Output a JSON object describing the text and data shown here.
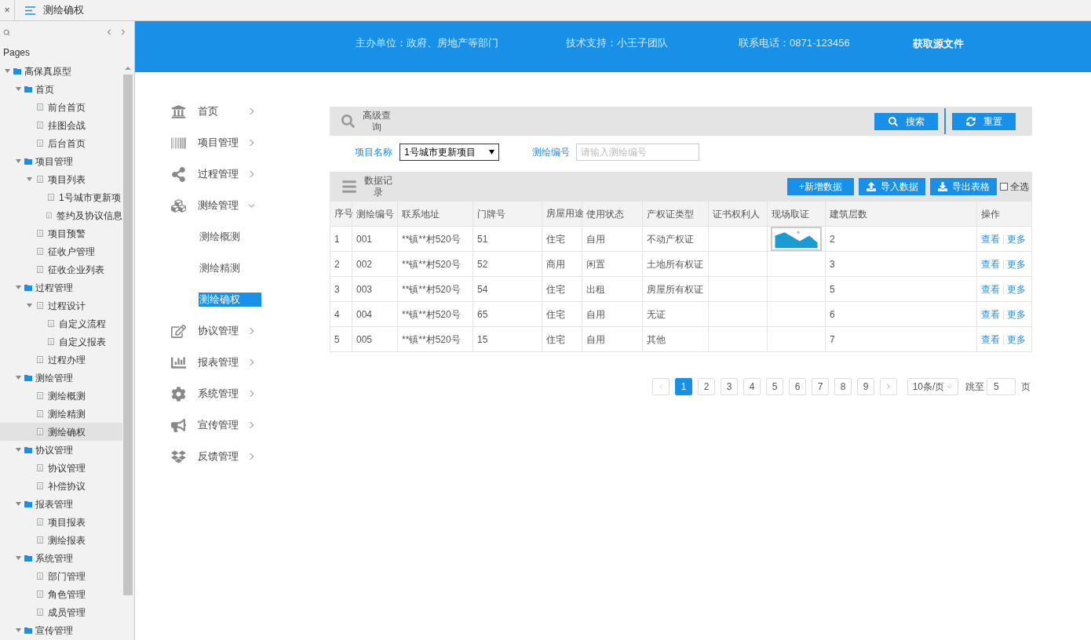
{
  "tab": {
    "close": "×",
    "title": "测绘确权"
  },
  "sidebar": {
    "heading": "Pages",
    "tree": [
      {
        "label": "高保真原型",
        "kind": "folder",
        "expanded": true,
        "selected": false,
        "children": [
          {
            "label": "首页",
            "kind": "folder",
            "expanded": true,
            "selected": false,
            "children": [
              {
                "label": "前台首页",
                "kind": "page",
                "selected": false
              },
              {
                "label": "挂图会战",
                "kind": "page",
                "selected": false
              },
              {
                "label": "后台首页",
                "kind": "page",
                "selected": false
              }
            ]
          },
          {
            "label": "项目管理",
            "kind": "folder",
            "expanded": true,
            "selected": false,
            "children": [
              {
                "label": "项目列表",
                "kind": "page",
                "expanded": true,
                "selected": false,
                "children": [
                  {
                    "label": "1号城市更新项",
                    "kind": "page",
                    "selected": false
                  },
                  {
                    "label": "签约及协议信息",
                    "kind": "page",
                    "selected": false
                  }
                ]
              },
              {
                "label": "项目预警",
                "kind": "page",
                "selected": false
              },
              {
                "label": "征收户管理",
                "kind": "page",
                "selected": false
              },
              {
                "label": "征收企业列表",
                "kind": "page",
                "selected": false
              }
            ]
          },
          {
            "label": "过程管理",
            "kind": "folder",
            "expanded": true,
            "selected": false,
            "children": [
              {
                "label": "过程设计",
                "kind": "page",
                "expanded": true,
                "selected": false,
                "children": [
                  {
                    "label": "自定义流程",
                    "kind": "page",
                    "selected": false
                  },
                  {
                    "label": "自定义报表",
                    "kind": "page",
                    "selected": false
                  }
                ]
              },
              {
                "label": "过程办理",
                "kind": "page",
                "selected": false
              }
            ]
          },
          {
            "label": "测绘管理",
            "kind": "folder",
            "expanded": true,
            "selected": false,
            "children": [
              {
                "label": "测绘概测",
                "kind": "page",
                "selected": false
              },
              {
                "label": "测绘精测",
                "kind": "page",
                "selected": false
              },
              {
                "label": "测绘确权",
                "kind": "page",
                "selected": true
              }
            ]
          },
          {
            "label": "协议管理",
            "kind": "folder",
            "expanded": true,
            "selected": false,
            "children": [
              {
                "label": "协议管理",
                "kind": "page",
                "selected": false
              },
              {
                "label": "补偿协议",
                "kind": "page",
                "selected": false
              }
            ]
          },
          {
            "label": "报表管理",
            "kind": "folder",
            "expanded": true,
            "selected": false,
            "children": [
              {
                "label": "项目报表",
                "kind": "page",
                "selected": false
              },
              {
                "label": "测绘报表",
                "kind": "page",
                "selected": false
              }
            ]
          },
          {
            "label": "系统管理",
            "kind": "folder",
            "expanded": true,
            "selected": false,
            "children": [
              {
                "label": "部门管理",
                "kind": "page",
                "selected": false
              },
              {
                "label": "角色管理",
                "kind": "page",
                "selected": false
              },
              {
                "label": "成员管理",
                "kind": "page",
                "selected": false
              }
            ]
          },
          {
            "label": "宣传管理",
            "kind": "folder",
            "expanded": true,
            "selected": false
          }
        ]
      }
    ]
  },
  "header": {
    "sponsor": "主办单位：政府、房地产等部门",
    "support": "技术支持：小王子团队",
    "phone": "联系电话：0871-123456",
    "link": "获取源文件"
  },
  "nav": [
    {
      "label": "首页",
      "expanded": false
    },
    {
      "label": "项目管理",
      "expanded": false
    },
    {
      "label": "过程管理",
      "expanded": false
    },
    {
      "label": "测绘管理",
      "expanded": true,
      "children": [
        {
          "label": "测绘概测",
          "selected": false
        },
        {
          "label": "测绘精测",
          "selected": false
        },
        {
          "label": "测绘确权",
          "selected": true
        }
      ]
    },
    {
      "label": "协议管理",
      "expanded": false
    },
    {
      "label": "报表管理",
      "expanded": false
    },
    {
      "label": "系统管理",
      "expanded": false
    },
    {
      "label": "宣传管理",
      "expanded": false
    },
    {
      "label": "反馈管理",
      "expanded": false
    }
  ],
  "search_panel": {
    "title": "高级查询",
    "search_button": "搜索",
    "reset_button": "重置",
    "project_label": "项目名称",
    "project_value": "1号城市更新项目",
    "code_label": "测绘编号",
    "code_placeholder": "请输入测绘编号"
  },
  "data_panel": {
    "title": "数据记录",
    "add_button": "+新增数据",
    "import_button": "导入数据",
    "export_button": "导出表格",
    "select_all": {
      "label": "全选",
      "checked": false
    }
  },
  "table": {
    "columns": [
      "序号",
      "测绘编号",
      "联系地址",
      "门牌号",
      "房屋用途",
      "使用状态",
      "产权证类型",
      "证书权利人",
      "现场取证",
      "建筑层数",
      "操作"
    ],
    "rows": [
      {
        "no": "1",
        "code": "001",
        "address": "**镇**村520号",
        "door": "51",
        "use": "住宅",
        "status": "自用",
        "cert": "不动产权证",
        "photo": true,
        "floors": "2",
        "actions": [
          "查看",
          "更多"
        ]
      },
      {
        "no": "2",
        "code": "002",
        "address": "**镇**村520号",
        "door": "52",
        "use": "商用",
        "status": "闲置",
        "cert": "土地所有权证",
        "photo": false,
        "floors": "3",
        "actions": [
          "查看",
          "更多"
        ]
      },
      {
        "no": "3",
        "code": "003",
        "address": "**镇**村520号",
        "door": "54",
        "use": "住宅",
        "status": "出租",
        "cert": "房屋所有权证",
        "photo": false,
        "floors": "5",
        "actions": [
          "查看",
          "更多"
        ]
      },
      {
        "no": "4",
        "code": "004",
        "address": "**镇**村520号",
        "door": "65",
        "use": "住宅",
        "status": "自用",
        "cert": "无证",
        "photo": false,
        "floors": "6",
        "actions": [
          "查看",
          "更多"
        ]
      },
      {
        "no": "5",
        "code": "005",
        "address": "**镇**村520号",
        "door": "15",
        "use": "住宅",
        "status": "自用",
        "cert": "其他",
        "photo": false,
        "floors": "7",
        "actions": [
          "查看",
          "更多"
        ]
      }
    ]
  },
  "pagination": {
    "pages": [
      {
        "label": "1",
        "selected": true
      },
      {
        "label": "2",
        "selected": false
      },
      {
        "label": "3",
        "selected": false
      },
      {
        "label": "4",
        "selected": false
      },
      {
        "label": "5",
        "selected": false
      },
      {
        "label": "6",
        "selected": false
      },
      {
        "label": "7",
        "selected": false
      },
      {
        "label": "8",
        "selected": false
      },
      {
        "label": "9",
        "selected": false
      }
    ],
    "page_size": "10条/页",
    "jump_label": "跳至",
    "jump_value": "5",
    "page_unit": "页"
  }
}
